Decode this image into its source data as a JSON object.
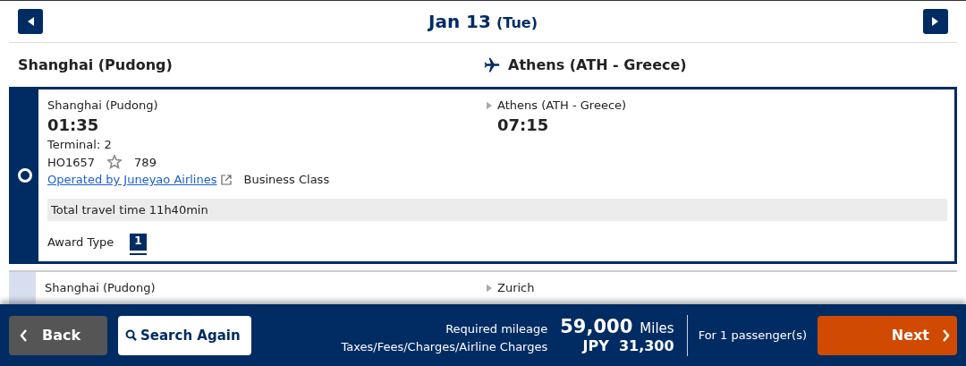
{
  "date_nav": {
    "date": "Jan 13",
    "weekday": "(Tue)"
  },
  "route": {
    "origin": "Shanghai (Pudong)",
    "destination": "Athens (ATH - Greece)"
  },
  "flights": [
    {
      "selected": true,
      "origin": "Shanghai (Pudong)",
      "departure": "01:35",
      "terminal": "Terminal: 2",
      "flight_number": "HO1657",
      "aircraft": "789",
      "operator_link": "Operated by Juneyao Airlines",
      "cabin": "Business Class",
      "destination": "Athens (ATH - Greece)",
      "arrival": "07:15",
      "travel_time": "Total travel time 11h40min",
      "award_type_label": "Award Type",
      "award_type": "1"
    },
    {
      "selected": false,
      "origin": "Shanghai (Pudong)",
      "destination": "Zurich"
    }
  ],
  "footer": {
    "back": "Back",
    "search_again": "Search Again",
    "mileage_label": "Required mileage",
    "mileage": "59,000",
    "mileage_unit": "Miles",
    "taxes_label": "Taxes/Fees/Charges/Airline Charges",
    "taxes_currency": "JPY",
    "taxes": "31,300",
    "passengers": "For 1 passenger(s)",
    "next": "Next"
  }
}
